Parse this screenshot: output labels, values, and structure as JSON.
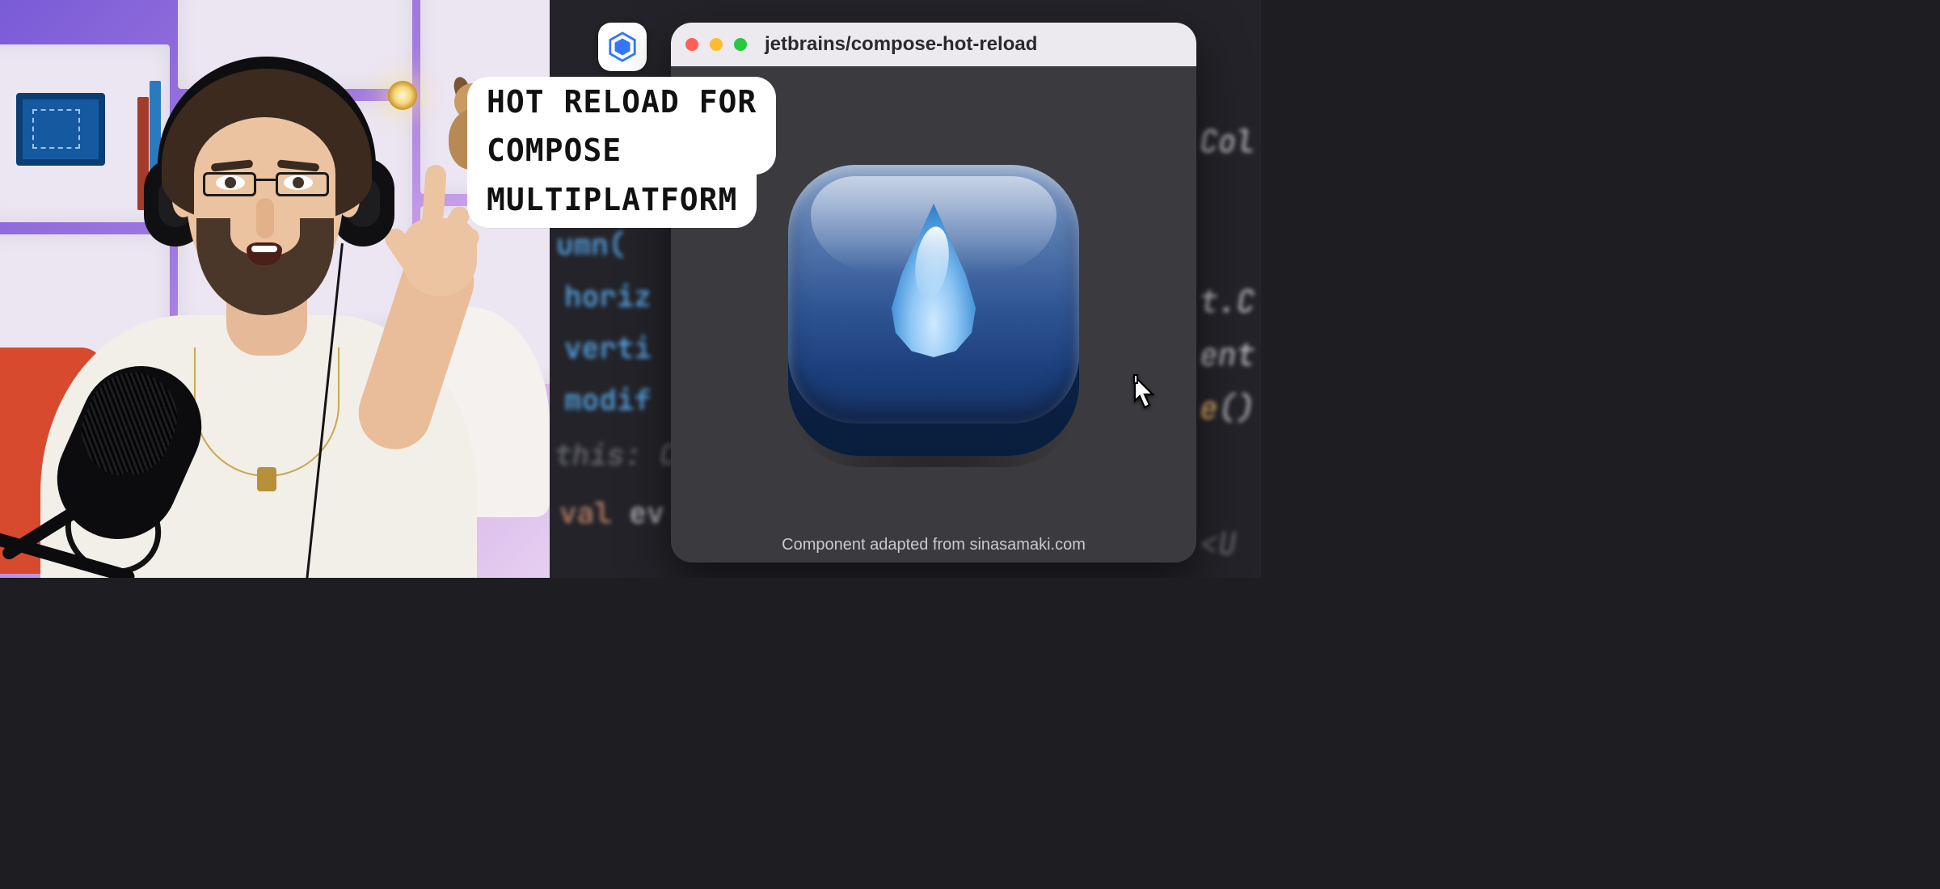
{
  "overlay": {
    "line1": "HOT RELOAD FOR",
    "line2": "COMPOSE",
    "line3": "MULTIPLATFORM"
  },
  "preview_window": {
    "title": "jetbrains/compose-hot-reload",
    "credit": "Component adapted from sinasamaki.com"
  },
  "code": {
    "frag_umn": "umn(",
    "params": [
      "horiz",
      "verti",
      "modif"
    ],
    "hint_this": "this: ",
    "hint_co": "Co",
    "kw_val": "val",
    "ident_ev": " ev"
  },
  "right_code": {
    "r1": "Col",
    "r2": "t.C",
    "r3": "ent",
    "r4": "e",
    "r4b": "()",
    "r5": "<U"
  },
  "icons": {
    "jetbrains_chip": "jetbrains-toolbox-icon",
    "close": "close-dot",
    "minimize": "minimize-dot",
    "zoom": "zoom-dot",
    "aqua_button": "water-drop-icon",
    "cursor": "pointer-cursor-icon"
  }
}
